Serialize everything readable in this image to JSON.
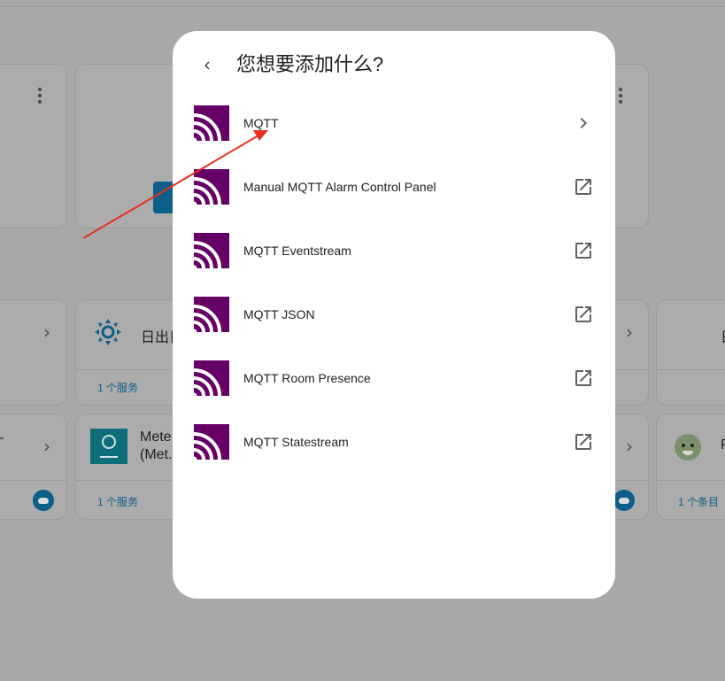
{
  "dialog": {
    "title": "您想要添加什么?",
    "items": [
      {
        "label": "MQTT",
        "trailing_icon": "chevron-right-icon"
      },
      {
        "label": "Manual MQTT Alarm Control Panel",
        "trailing_icon": "open-in-new-icon"
      },
      {
        "label": "MQTT Eventstream",
        "trailing_icon": "open-in-new-icon"
      },
      {
        "label": "MQTT JSON",
        "trailing_icon": "open-in-new-icon"
      },
      {
        "label": "MQTT Room Presence",
        "trailing_icon": "open-in-new-icon"
      },
      {
        "label": "MQTT Statestream",
        "trailing_icon": "open-in-new-icon"
      }
    ]
  },
  "background": {
    "cards": [
      {
        "name": "日出日",
        "link": "1 个服务"
      },
      {
        "name_line1": "Mete",
        "name_line2": "(Met.",
        "link": "1 个服务"
      },
      {
        "name": "日"
      },
      {
        "name": "R",
        "link": "1 个条目"
      }
    ],
    "dash": "-"
  },
  "colors": {
    "overlay": "#a8a8a8",
    "mqtt_purple": "#660066",
    "link_blue": "#0d5e86",
    "annotation_red": "#e8321e"
  }
}
